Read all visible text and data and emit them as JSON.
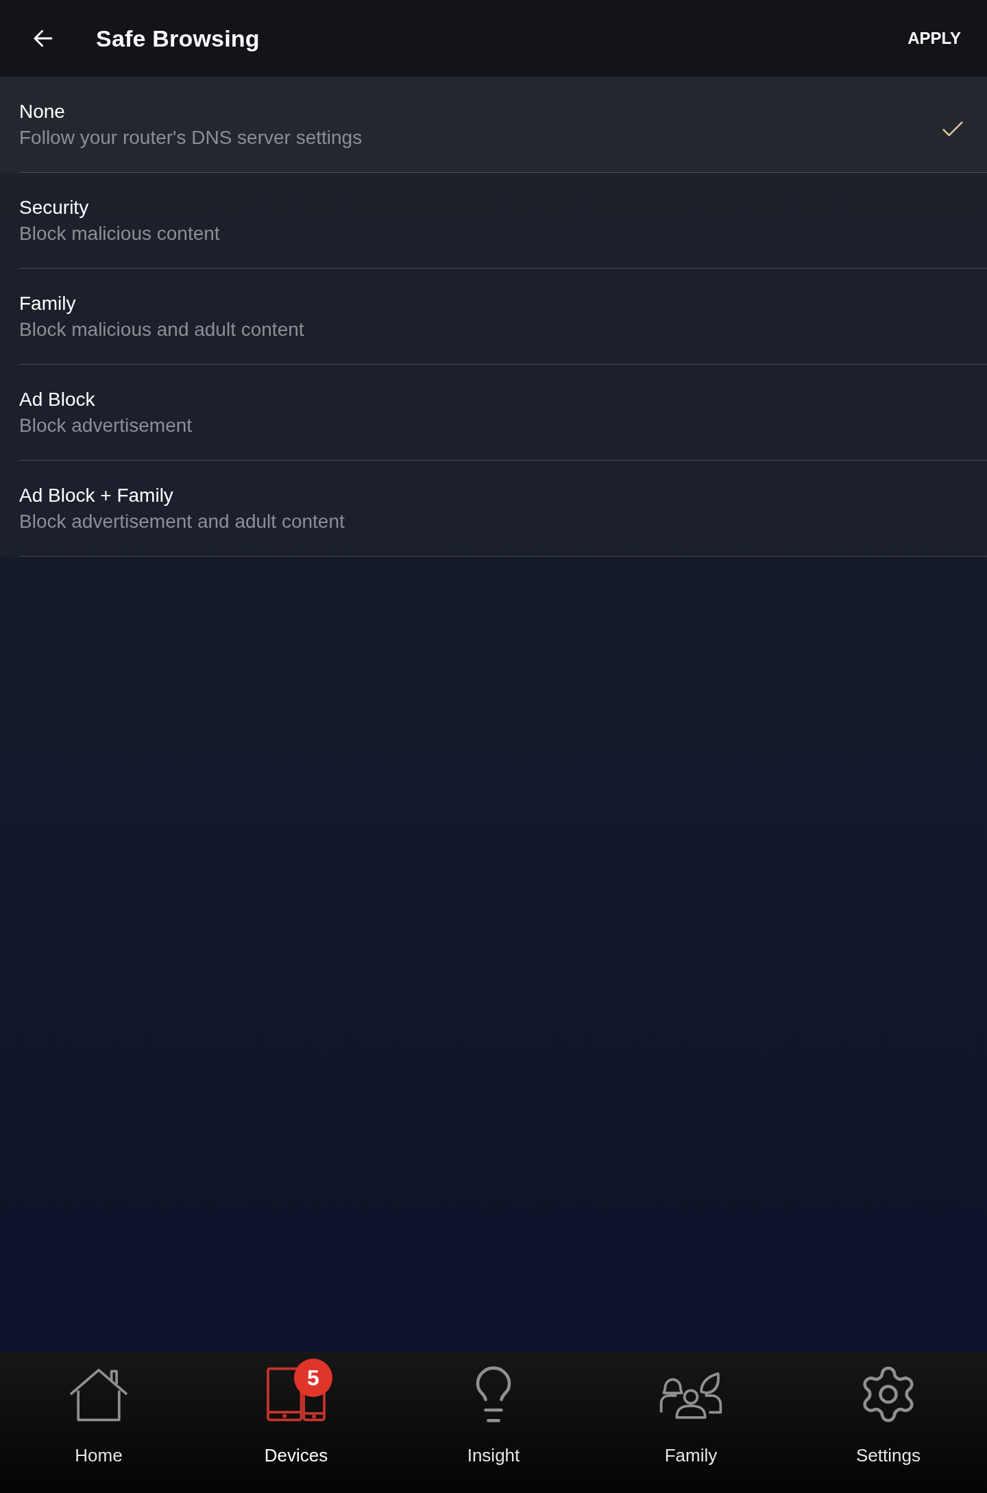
{
  "header": {
    "title": "Safe Browsing",
    "action": "APPLY"
  },
  "options": [
    {
      "title": "None",
      "description": "Follow your router's DNS server settings",
      "selected": true
    },
    {
      "title": "Security",
      "description": "Block malicious content",
      "selected": false
    },
    {
      "title": "Family",
      "description": "Block malicious and adult content",
      "selected": false
    },
    {
      "title": "Ad Block",
      "description": "Block advertisement",
      "selected": false
    },
    {
      "title": "Ad Block + Family",
      "description": "Block advertisement and adult content",
      "selected": false
    }
  ],
  "nav": [
    {
      "label": "Home",
      "selected": false
    },
    {
      "label": "Devices",
      "selected": true,
      "badge": "5"
    },
    {
      "label": "Insight",
      "selected": false
    },
    {
      "label": "Family",
      "selected": false
    },
    {
      "label": "Settings",
      "selected": false
    }
  ]
}
